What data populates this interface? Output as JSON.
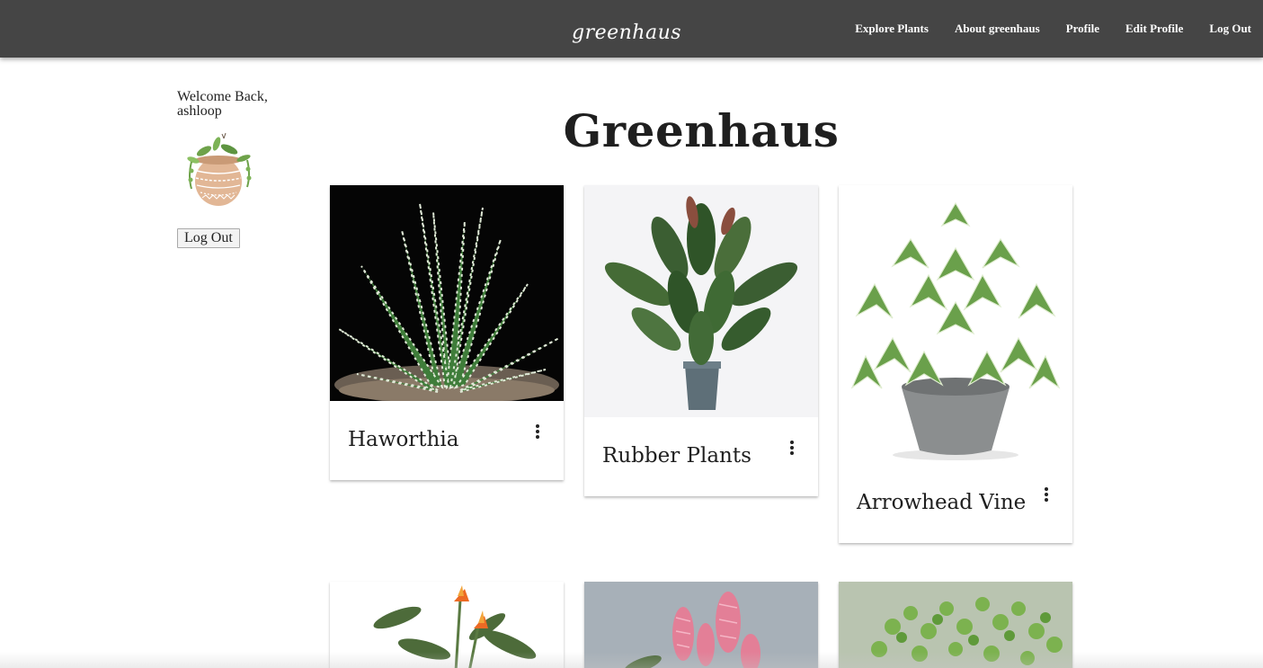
{
  "navbar": {
    "brand": "greenhaus",
    "links": [
      "Explore Plants",
      "About greenhaus",
      "Profile",
      "Edit Profile",
      "Log Out"
    ]
  },
  "sidebar": {
    "welcome": "Welcome Back,",
    "username": "ashloop",
    "logout_label": "Log Out"
  },
  "main": {
    "title": "Greenhaus",
    "plants": [
      {
        "name": "Haworthia"
      },
      {
        "name": "Rubber Plants"
      },
      {
        "name": "Arrowhead Vine"
      },
      {
        "name": ""
      },
      {
        "name": ""
      },
      {
        "name": ""
      }
    ]
  },
  "colors": {
    "navbar_bg": "#454545",
    "text": "#1f1f1f"
  }
}
